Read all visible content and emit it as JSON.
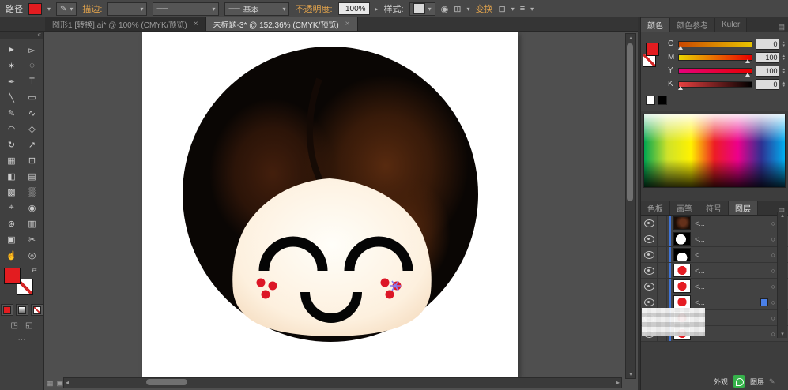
{
  "control_bar": {
    "path_label": "路径",
    "fill_color": "#e31c20",
    "stroke_label": "描边:",
    "brush_name": "基本",
    "opacity_label": "不透明度:",
    "opacity_value": "100%",
    "style_label": "样式:",
    "transform_label": "变换"
  },
  "document_tabs": [
    {
      "title": "图形1 [转换].ai* @ 100% (CMYK/预览)",
      "close_label": "×",
      "active": false
    },
    {
      "title": "未标题-3* @ 152.36% (CMYK/预览)",
      "close_label": "×",
      "active": true
    }
  ],
  "tools": [
    {
      "name": "selection-tool",
      "glyph": "►"
    },
    {
      "name": "direct-selection-tool",
      "glyph": "▻"
    },
    {
      "name": "magic-wand-tool",
      "glyph": "✶"
    },
    {
      "name": "lasso-tool",
      "glyph": "◌"
    },
    {
      "name": "pen-tool",
      "glyph": "✒"
    },
    {
      "name": "type-tool",
      "glyph": "T"
    },
    {
      "name": "line-tool",
      "glyph": "╲"
    },
    {
      "name": "rectangle-tool",
      "glyph": "▭"
    },
    {
      "name": "paintbrush-tool",
      "glyph": "✎"
    },
    {
      "name": "pencil-tool",
      "glyph": "∿"
    },
    {
      "name": "blob-brush-tool",
      "glyph": "◠"
    },
    {
      "name": "eraser-tool",
      "glyph": "◇"
    },
    {
      "name": "rotate-tool",
      "glyph": "↻"
    },
    {
      "name": "scale-tool",
      "glyph": "↗"
    },
    {
      "name": "width-tool",
      "glyph": "▦"
    },
    {
      "name": "free-transform-tool",
      "glyph": "⊡"
    },
    {
      "name": "shape-builder-tool",
      "glyph": "◧"
    },
    {
      "name": "perspective-grid-tool",
      "glyph": "▤"
    },
    {
      "name": "mesh-tool",
      "glyph": "▩"
    },
    {
      "name": "gradient-tool",
      "glyph": "▒"
    },
    {
      "name": "eyedropper-tool",
      "glyph": "⌖"
    },
    {
      "name": "blend-tool",
      "glyph": "◉"
    },
    {
      "name": "symbol-sprayer-tool",
      "glyph": "⊛"
    },
    {
      "name": "graph-tool",
      "glyph": "▥"
    },
    {
      "name": "artboard-tool",
      "glyph": "▣"
    },
    {
      "name": "slice-tool",
      "glyph": "✂"
    },
    {
      "name": "hand-tool",
      "glyph": "☝"
    },
    {
      "name": "zoom-tool",
      "glyph": "◎"
    }
  ],
  "color_panel": {
    "tabs": [
      {
        "label": "颜色",
        "active": true
      },
      {
        "label": "颜色参考",
        "active": false
      },
      {
        "label": "Kuler",
        "active": false
      }
    ],
    "sliders": [
      {
        "label": "C",
        "value": "0",
        "g1": "#c84600",
        "g2": "#e8c400"
      },
      {
        "label": "M",
        "value": "100",
        "g1": "#e8d400",
        "g2": "#e80000"
      },
      {
        "label": "Y",
        "value": "100",
        "g1": "#e8007c",
        "g2": "#e80000"
      },
      {
        "label": "K",
        "value": "0",
        "g1": "#e84040",
        "g2": "#000000"
      }
    ]
  },
  "lower_panel": {
    "tabs": [
      {
        "label": "色板",
        "active": false
      },
      {
        "label": "画笔",
        "active": false
      },
      {
        "label": "符号",
        "active": false
      },
      {
        "label": "图层",
        "active": true
      }
    ],
    "layers": [
      {
        "name": "<...",
        "thumb": "hair",
        "extra": false
      },
      {
        "name": "<...",
        "thumb": "moon",
        "extra": false
      },
      {
        "name": "<...",
        "thumb": "bw",
        "extra": false
      },
      {
        "name": "<...",
        "thumb": "red",
        "extra": false
      },
      {
        "name": "<...",
        "thumb": "red",
        "extra": false
      },
      {
        "name": "<...",
        "thumb": "red",
        "extra": true
      },
      {
        "name": "<...",
        "thumb": "red",
        "extra": false
      },
      {
        "name": "<...",
        "thumb": "red",
        "extra": false
      }
    ]
  },
  "status": {
    "appearance_label": "外观",
    "layers_label": "图层"
  },
  "icons": {
    "caret_down": "▾",
    "menu": "▤",
    "panel_menu": "≡",
    "collapse_left": "«",
    "pen_glyph": "✎",
    "line_glyph": "──",
    "circle_glyph": "◉",
    "grid_glyph": "⊞",
    "doc_glyph": "⊟",
    "spinner_up": "▴",
    "spinner_down": "▾",
    "target": "○",
    "scroll_left": "◂",
    "scroll_right": "▸",
    "scroll_up": "▴",
    "scroll_down": "▾",
    "ellipsis": "⋯",
    "swap": "⇄",
    "draw_normal": "◳",
    "draw_behind": "◱",
    "taskbar_1": "▦",
    "taskbar_2": "▣"
  }
}
